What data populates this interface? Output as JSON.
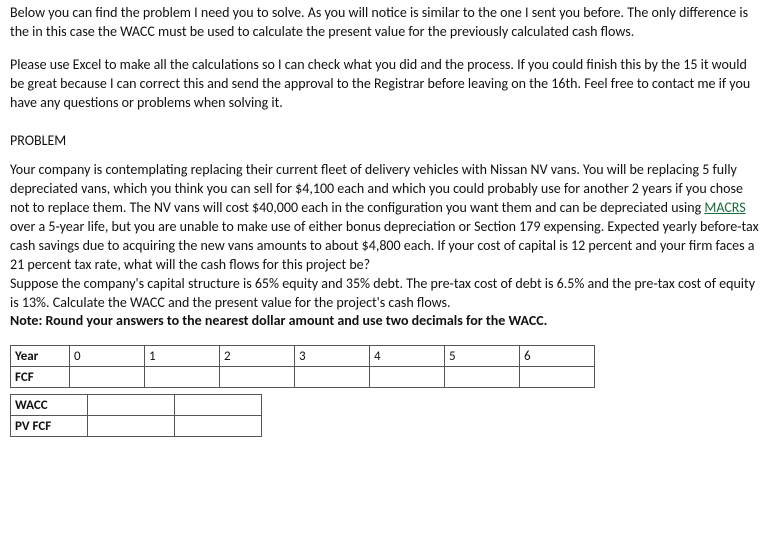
{
  "intro": {
    "p1": "Below you can find the problem I need you to solve. As you will notice is similar to the one I sent you before. The only difference is the in this case the WACC must be used to calculate the present value for the previously calculated cash flows.",
    "p2": "Please use Excel to make all the calculations so I can check what you did and the process. If you could finish this by the 15 it would be great because I can correct this and send the approval to the Registrar before leaving on the 16th. Feel free to contact me if you have any questions or problems when solving it."
  },
  "heading": "PROBLEM",
  "problem": {
    "p1a": "Your company is contemplating replacing their current fleet of delivery vehicles with Nissan NV vans. You will be replacing 5 fully depreciated vans, which you think you can sell for $4,100 each and which you could probably use for another 2 years if you chose not to replace them. The NV vans will cost $40,000 each in the configuration you want them and can be depreciated using ",
    "link_text": "MACRS",
    "p1b": " over a 5-year life, but you are unable to make use of either bonus depreciation or Section 179 expensing. Expected yearly before-tax cash savings due to acquiring the new vans amounts to about $4,800 each. If your cost of capital is 12 percent and your firm faces a 21 percent tax rate, what will the cash flows for this project be?",
    "p2": "Suppose the company's capital structure is 65% equity and 35% debt. The pre-tax cost of debt is 6.5% and the pre-tax cost of equity is 13%. Calculate the WACC and the present value for the project's cash flows.",
    "note": "Note: Round your answers to the nearest dollar amount and use two decimals for the WACC."
  },
  "table1": {
    "row0_label": "Year",
    "headers": [
      "0",
      "1",
      "2",
      "3",
      "4",
      "5",
      "6"
    ],
    "row1_label": "FCF",
    "values": [
      "",
      "",
      "",
      "",
      "",
      "",
      ""
    ]
  },
  "table2": {
    "row0_label": "WACC",
    "row0_values": [
      "",
      ""
    ],
    "row1_label": "PV FCF",
    "row1_values": [
      "",
      ""
    ]
  }
}
